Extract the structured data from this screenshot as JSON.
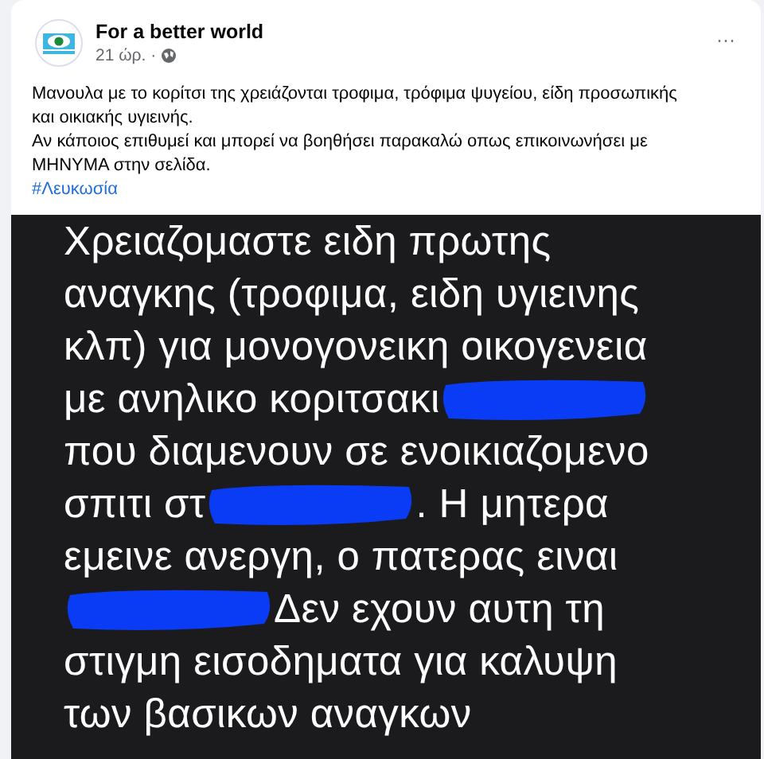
{
  "post": {
    "author": "For a better world",
    "time": "21 ώρ. ·",
    "more": "···",
    "text_lines": [
      "Μανουλα με το κορίτσι της χρειάζονται τροφιμα, τρόφιμα ψυγείου, είδη προσωπικής και οικιακής υγιεινής.",
      "Αν κάποιος επιθυμεί και μπορεί να βοηθήσει παρακαλώ οπως επικοινωνήσει με ΜΗΝΥΜΑ στην σελίδα."
    ],
    "hashtag": "#Λευκωσία"
  },
  "attached_image": {
    "lines": [
      {
        "segments": [
          {
            "kind": "text",
            "text": "Χρειαζομαστε ειδη πρωτης"
          }
        ]
      },
      {
        "segments": [
          {
            "kind": "text",
            "text": "αναγκης (τροφιμα, ειδη υγιεινης"
          }
        ]
      },
      {
        "segments": [
          {
            "kind": "text",
            "text": "κλπ) για μονογονεικη οικογενεια"
          }
        ]
      },
      {
        "segments": [
          {
            "kind": "text",
            "text": "με ανηλικο κοριτσακι"
          },
          {
            "kind": "redaction"
          }
        ]
      },
      {
        "segments": [
          {
            "kind": "text",
            "text": "που διαμενουν σε ενοικιαζομενο"
          }
        ]
      },
      {
        "segments": [
          {
            "kind": "text",
            "text": "σπιτι στ"
          },
          {
            "kind": "redaction"
          },
          {
            "kind": "text",
            "text": ". Η μητερα"
          }
        ]
      },
      {
        "segments": [
          {
            "kind": "text",
            "text": "εμεινε ανεργη, ο πατερας ειναι"
          }
        ]
      },
      {
        "segments": [
          {
            "kind": "redaction"
          },
          {
            "kind": "text",
            "text": " Δεν εχουν αυτη τη"
          }
        ]
      },
      {
        "segments": [
          {
            "kind": "text",
            "text": "στιγμη εισοδηματα για καλυψη"
          }
        ]
      },
      {
        "segments": [
          {
            "kind": "text",
            "text": "των βασικων αναγκων"
          }
        ]
      }
    ]
  }
}
